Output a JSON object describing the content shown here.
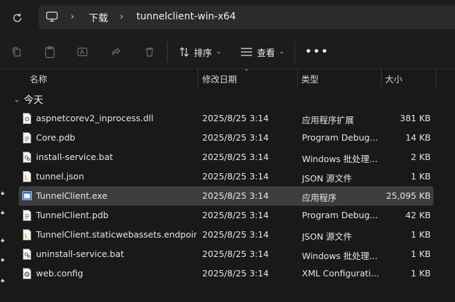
{
  "address_bar": {
    "crumbs": [
      "下载",
      "tunnelclient-win-x64"
    ]
  },
  "toolbar": {
    "sort_label": "排序",
    "view_label": "查看",
    "more_label": "•••"
  },
  "columns": {
    "name": "名称",
    "date": "修改日期",
    "type": "类型",
    "size": "大小"
  },
  "group": {
    "label": "今天"
  },
  "files": [
    {
      "name": "aspnetcorev2_inprocess.dll",
      "date": "2025/8/25 3:14",
      "type": "应用程序扩展",
      "size": "381 KB",
      "icon": "dll-file-icon"
    },
    {
      "name": "Core.pdb",
      "date": "2025/8/25 3:14",
      "type": "Program Debug...",
      "size": "14 KB",
      "icon": "pdb-file-icon"
    },
    {
      "name": "install-service.bat",
      "date": "2025/8/25 3:14",
      "type": "Windows 批处理...",
      "size": "2 KB",
      "icon": "bat-file-icon"
    },
    {
      "name": "tunnel.json",
      "date": "2025/8/25 3:14",
      "type": "JSON 源文件",
      "size": "1 KB",
      "icon": "json-file-icon"
    },
    {
      "name": "TunnelClient.exe",
      "date": "2025/8/25 3:14",
      "type": "应用程序",
      "size": "25,095 KB",
      "icon": "exe-file-icon"
    },
    {
      "name": "TunnelClient.pdb",
      "date": "2025/8/25 3:14",
      "type": "Program Debug...",
      "size": "42 KB",
      "icon": "pdb-file-icon"
    },
    {
      "name": "TunnelClient.staticwebassets.endpoin...",
      "date": "2025/8/25 3:14",
      "type": "JSON 源文件",
      "size": "1 KB",
      "icon": "json-file-icon"
    },
    {
      "name": "uninstall-service.bat",
      "date": "2025/8/25 3:14",
      "type": "Windows 批处理...",
      "size": "1 KB",
      "icon": "bat-file-icon"
    },
    {
      "name": "web.config",
      "date": "2025/8/25 3:14",
      "type": "XML Configurati...",
      "size": "1 KB",
      "icon": "config-file-icon"
    }
  ],
  "selected_file": "TunnelClient.exe"
}
